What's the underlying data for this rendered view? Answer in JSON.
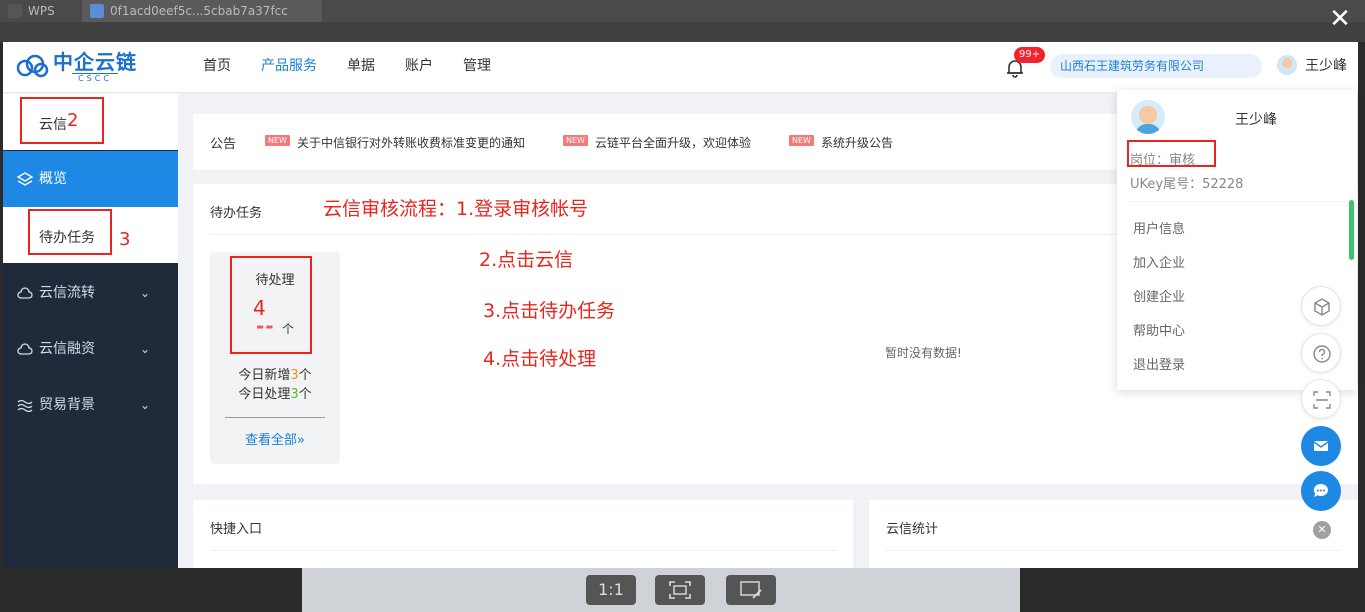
{
  "browser": {
    "tabs": [
      {
        "label": "WPS"
      },
      {
        "label": "0f1acd0eef5c...5cbab7a37fcc"
      }
    ],
    "close_label": "✕"
  },
  "header": {
    "logo_text": "中企云链",
    "logo_sub": "CSCC",
    "nav": [
      "首页",
      "产品服务",
      "单据",
      "账户",
      "管理"
    ],
    "nav_active": "产品服务",
    "badge": "99+",
    "company": "山西石王建筑劳务有限公司",
    "user": "王少峰"
  },
  "sidebar": {
    "yunxin": "云信",
    "overview": "概览",
    "todo": "待办任务",
    "items": [
      "云信流转",
      "云信融资",
      "贸易背景"
    ]
  },
  "notice": {
    "label": "公告",
    "tag": "NEW",
    "items": [
      "关于中信银行对外转账收费标准变更的通知",
      "云链平台全面升级，欢迎体验",
      "系统升级公告"
    ]
  },
  "todo": {
    "title": "待办任务",
    "pending_label": "待处理",
    "pending_value": "--",
    "unit": "个",
    "new_today_prefix": "今日新增",
    "new_today_count": "3",
    "handled_today_prefix": "今日处理",
    "handled_today_count": "3",
    "view_all": "查看全部»",
    "no_data": "暂时没有数据!"
  },
  "quick": {
    "title": "快捷入口"
  },
  "stat": {
    "title": "云信统计"
  },
  "annotations": {
    "n2": "2",
    "n3": "3",
    "n4": "4",
    "step1": "云信审核流程：1.登录审核帐号",
    "step2": "2.点击云信",
    "step3": "3.点击待办任务",
    "step4": "4.点击待处理"
  },
  "dropdown": {
    "name": "王少峰",
    "position": "岗位：审核",
    "ukey": "UKey尾号：52228",
    "items": [
      "用户信息",
      "加入企业",
      "创建企业",
      "帮助中心",
      "退出登录"
    ]
  },
  "viewer": {
    "ratio": "1:1"
  },
  "colors": {
    "primary": "#1e88e5",
    "annotation": "#e8261d",
    "sidebar": "#1f2a3a"
  }
}
